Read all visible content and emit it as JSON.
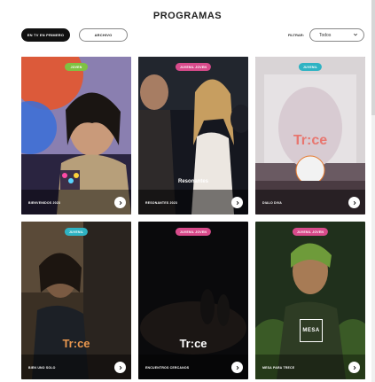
{
  "header": {
    "title": "PROGRAMAS"
  },
  "filters": {
    "active_label": "EN TV EN PRIMERO",
    "inactive_label": "ARCHIVO",
    "select_label": "FILTRAR:",
    "select_value": "Todos"
  },
  "cards": [
    {
      "badge": "JOVEN",
      "title": "BIENVENIDOS 2023",
      "badge_color": "#7fc242"
    },
    {
      "badge": "JUVENIL JOVEN",
      "title": "RESONANTES 2023",
      "badge_color": "#d84b8b",
      "logo_text": "Resonantes"
    },
    {
      "badge": "JUVENIL",
      "title": "DIALO DIVA",
      "badge_color": "#2fb3c3",
      "logo_text": "Tr:ce"
    },
    {
      "badge": "JUVENIL",
      "title": "BIEN UNO SOLO",
      "badge_color": "#2fb3c3",
      "logo_text": "Tr:ce"
    },
    {
      "badge": "JUVENIL JOVEN",
      "title": "ENCUENTROS CERCANOS",
      "badge_color": "#d84b8b",
      "logo_text": "Tr:ce"
    },
    {
      "badge": "JUVENIL JOVEN",
      "title": "MESA PARA TRECE",
      "badge_color": "#d84b8b",
      "logo_text": "MESA"
    }
  ],
  "icons": {
    "arrow": "chevron-right-icon",
    "dropdown": "chevron-down-icon"
  }
}
